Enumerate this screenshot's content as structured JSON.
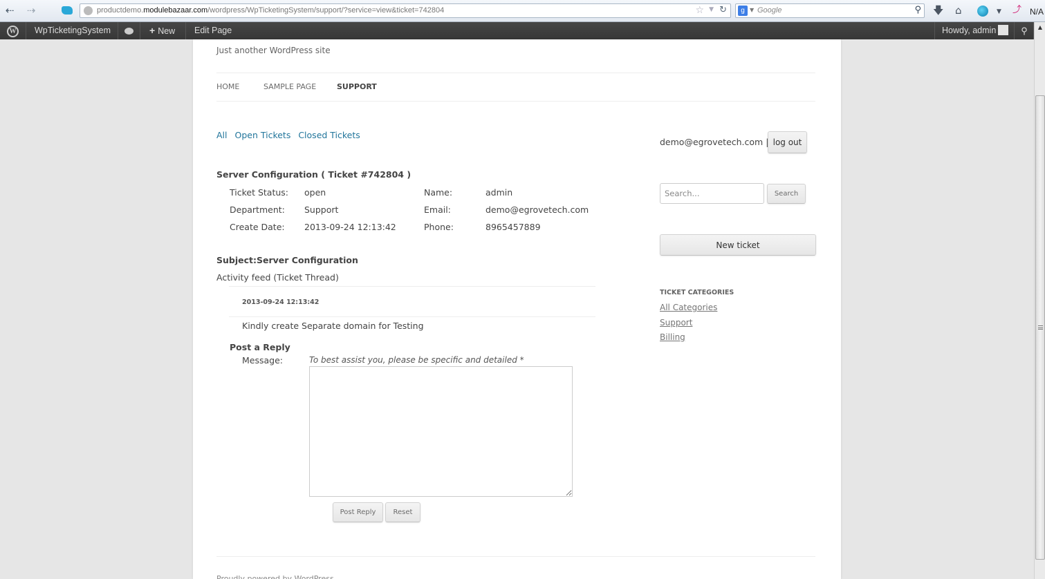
{
  "browser": {
    "url_prefix": "productdemo.",
    "url_domain": "modulebazaar.com",
    "url_path": "/wordpress/WpTicketingSystem/support/?service=view&ticket=742804",
    "search_engine_placeholder": "Google",
    "addon_label": "N/A"
  },
  "admin_bar": {
    "site_name": "WpTicketingSystem",
    "new_label": "New",
    "edit_label": "Edit Page",
    "howdy": "Howdy, admin"
  },
  "site": {
    "tagline": "Just another WordPress site",
    "menu": [
      {
        "label": "HOME",
        "current": false
      },
      {
        "label": "SAMPLE PAGE",
        "current": false
      },
      {
        "label": "SUPPORT",
        "current": true
      }
    ],
    "footer": "Proudly powered by WordPress"
  },
  "filters": [
    "All",
    "Open Tickets",
    "Closed Tickets"
  ],
  "ticket": {
    "title": "Server Configuration ( Ticket #742804 )",
    "fields_left": [
      {
        "label": "Ticket Status:",
        "value": "open"
      },
      {
        "label": "Department:",
        "value": "Support"
      },
      {
        "label": "Create Date:",
        "value": "2013-09-24 12:13:42"
      }
    ],
    "fields_right": [
      {
        "label": "Name:",
        "value": "admin"
      },
      {
        "label": "Email:",
        "value": "demo@egrovetech.com"
      },
      {
        "label": "Phone:",
        "value": "8965457889"
      }
    ],
    "subject": "Subject:Server Configuration",
    "activity_heading": "Activity feed (Ticket Thread)",
    "thread": [
      {
        "date": "2013-09-24 12:13:42",
        "message": "Kindly create Separate domain for Testing"
      }
    ]
  },
  "reply": {
    "title": "Post a Reply",
    "message_label": "Message:",
    "hint": "To best assist you, please be specific and detailed *",
    "message_value": "",
    "post_label": "Post Reply",
    "reset_label": "Reset"
  },
  "sidebar": {
    "user_email": "demo@egrovetech.com |",
    "logout_label": "log out",
    "search_placeholder": "Search...",
    "search_button": "Search",
    "new_ticket": "New ticket",
    "categories_title": "TICKET CATEGORIES",
    "categories": [
      "All Categories",
      "Support",
      "Billing"
    ]
  }
}
